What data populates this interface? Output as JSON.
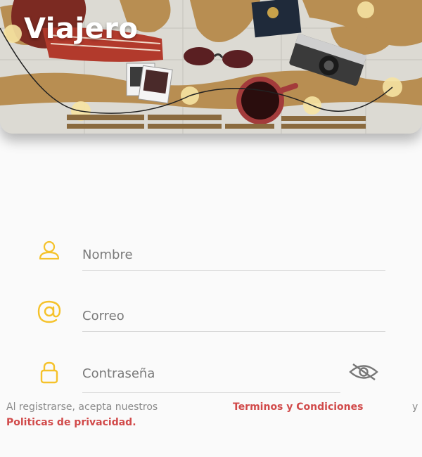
{
  "app": {
    "title": "Viajero"
  },
  "form": {
    "name_placeholder": "Nombre",
    "email_placeholder": "Correo",
    "password_placeholder": "Contraseña"
  },
  "legal": {
    "intro": "Al registrarse, acepta nuestros",
    "terms_link": "Terminos y Condiciones",
    "and": "y",
    "privacy_link": "Politicas de privacidad."
  },
  "colors": {
    "accent": "#f5c22a",
    "link": "#d14a4a",
    "placeholder": "#7a7a7a"
  },
  "icons": [
    "person-icon",
    "at-icon",
    "lock-icon",
    "eye-off-icon"
  ]
}
